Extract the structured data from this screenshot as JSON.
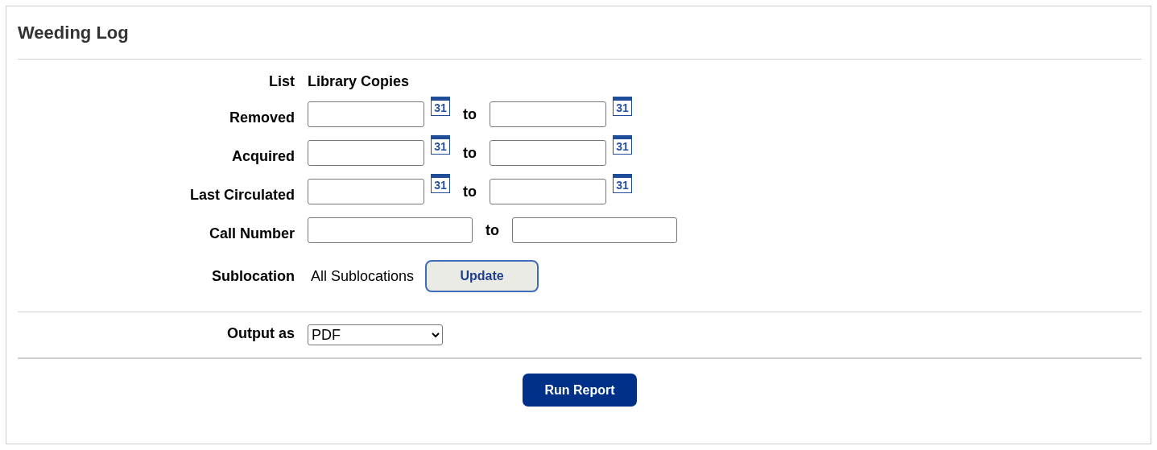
{
  "title": "Weeding Log",
  "list": {
    "label": "List",
    "value": "Library Copies"
  },
  "date_ranges": [
    {
      "label": "Removed",
      "from_icon": "31",
      "separator": "to",
      "to_icon": "31"
    },
    {
      "label": "Acquired",
      "from_icon": "31",
      "separator": "to",
      "to_icon": "31"
    },
    {
      "label": "Last Circulated",
      "from_icon": "31",
      "separator": "to",
      "to_icon": "31"
    }
  ],
  "call_number": {
    "label": "Call Number",
    "separator": "to"
  },
  "sublocation": {
    "label": "Sublocation",
    "value": "All Sublocations",
    "button": "Update"
  },
  "output": {
    "label": "Output as",
    "value": "PDF"
  },
  "run_button": "Run Report"
}
